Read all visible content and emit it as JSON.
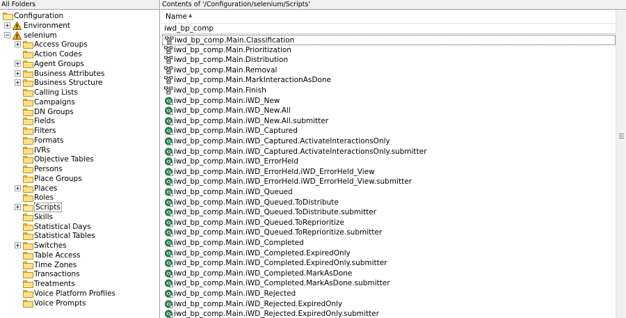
{
  "left_pane": {
    "header": "All Folders",
    "tree": [
      {
        "label": "Configuration",
        "level": 0,
        "expander": "none",
        "icon": "folder-open-icon"
      },
      {
        "label": "Environment",
        "level": 1,
        "expander": "plus",
        "icon": "warning-icon"
      },
      {
        "label": "selenium",
        "level": 1,
        "expander": "minus",
        "icon": "warning-icon"
      },
      {
        "label": "Access Groups",
        "level": 2,
        "expander": "plus",
        "icon": "folder-icon"
      },
      {
        "label": "Action Codes",
        "level": 2,
        "expander": "none",
        "icon": "folder-icon"
      },
      {
        "label": "Agent Groups",
        "level": 2,
        "expander": "plus",
        "icon": "folder-icon"
      },
      {
        "label": "Business Attributes",
        "level": 2,
        "expander": "plus",
        "icon": "folder-icon"
      },
      {
        "label": "Business Structure",
        "level": 2,
        "expander": "plus",
        "icon": "folder-icon"
      },
      {
        "label": "Calling Lists",
        "level": 2,
        "expander": "none",
        "icon": "folder-icon"
      },
      {
        "label": "Campaigns",
        "level": 2,
        "expander": "none",
        "icon": "folder-icon"
      },
      {
        "label": "DN Groups",
        "level": 2,
        "expander": "none",
        "icon": "folder-icon"
      },
      {
        "label": "Fields",
        "level": 2,
        "expander": "none",
        "icon": "folder-icon"
      },
      {
        "label": "Filters",
        "level": 2,
        "expander": "none",
        "icon": "folder-icon"
      },
      {
        "label": "Formats",
        "level": 2,
        "expander": "none",
        "icon": "folder-icon"
      },
      {
        "label": "IVRs",
        "level": 2,
        "expander": "none",
        "icon": "folder-icon"
      },
      {
        "label": "Objective Tables",
        "level": 2,
        "expander": "none",
        "icon": "folder-icon"
      },
      {
        "label": "Persons",
        "level": 2,
        "expander": "none",
        "icon": "folder-icon"
      },
      {
        "label": "Place Groups",
        "level": 2,
        "expander": "none",
        "icon": "folder-icon"
      },
      {
        "label": "Places",
        "level": 2,
        "expander": "plus",
        "icon": "folder-icon"
      },
      {
        "label": "Roles",
        "level": 2,
        "expander": "none",
        "icon": "folder-icon"
      },
      {
        "label": "Scripts",
        "level": 2,
        "expander": "plus",
        "icon": "folder-open-icon",
        "selected": true
      },
      {
        "label": "Skills",
        "level": 2,
        "expander": "none",
        "icon": "folder-icon"
      },
      {
        "label": "Statistical Days",
        "level": 2,
        "expander": "none",
        "icon": "folder-icon"
      },
      {
        "label": "Statistical Tables",
        "level": 2,
        "expander": "none",
        "icon": "folder-icon"
      },
      {
        "label": "Switches",
        "level": 2,
        "expander": "plus",
        "icon": "folder-icon"
      },
      {
        "label": "Table Access",
        "level": 2,
        "expander": "none",
        "icon": "folder-icon"
      },
      {
        "label": "Time Zones",
        "level": 2,
        "expander": "none",
        "icon": "folder-icon"
      },
      {
        "label": "Transactions",
        "level": 2,
        "expander": "none",
        "icon": "folder-icon"
      },
      {
        "label": "Treatments",
        "level": 2,
        "expander": "none",
        "icon": "folder-icon"
      },
      {
        "label": "Voice Platform Profiles",
        "level": 2,
        "expander": "none",
        "icon": "folder-icon"
      },
      {
        "label": "Voice Prompts",
        "level": 2,
        "expander": "none",
        "icon": "folder-icon"
      }
    ]
  },
  "right_pane": {
    "header": "Contents of '/Configuration/selenium/Scripts'",
    "column_name": "Name",
    "sort_indicator": "▲",
    "filter_value": "iwd_bp_comp",
    "items": [
      {
        "label": "iwd_bp_comp.Main.Classification",
        "icon": "workflow-icon"
      },
      {
        "label": "iwd_bp_comp.Main.Prioritization",
        "icon": "workflow-icon"
      },
      {
        "label": "iwd_bp_comp.Main.Distribution",
        "icon": "workflow-icon"
      },
      {
        "label": "iwd_bp_comp.Main.Removal",
        "icon": "workflow-icon"
      },
      {
        "label": "iwd_bp_comp.Main.MarkInteractionAsDone",
        "icon": "workflow-icon"
      },
      {
        "label": "iwd_bp_comp.Main.Finish",
        "icon": "workflow-icon"
      },
      {
        "label": "iwd_bp_comp.Main.iWD_New",
        "icon": "queue-icon"
      },
      {
        "label": "iwd_bp_comp.Main.iWD_New.All",
        "icon": "queue-icon"
      },
      {
        "label": "iwd_bp_comp.Main.iWD_New.All.submitter",
        "icon": "queue-icon"
      },
      {
        "label": "iwd_bp_comp.Main.iWD_Captured",
        "icon": "queue-icon"
      },
      {
        "label": "iwd_bp_comp.Main.iWD_Captured.ActivateInteractionsOnly",
        "icon": "queue-icon"
      },
      {
        "label": "iwd_bp_comp.Main.iWD_Captured.ActivateInteractionsOnly.submitter",
        "icon": "queue-icon"
      },
      {
        "label": "iwd_bp_comp.Main.iWD_ErrorHeld",
        "icon": "queue-icon"
      },
      {
        "label": "iwd_bp_comp.Main.iWD_ErrorHeld.iWD_ErrorHeld_View",
        "icon": "queue-icon"
      },
      {
        "label": "iwd_bp_comp.Main.iWD_ErrorHeld.iWD_ErrorHeld_View.submitter",
        "icon": "queue-icon"
      },
      {
        "label": "iwd_bp_comp.Main.iWD_Queued",
        "icon": "queue-icon"
      },
      {
        "label": "iwd_bp_comp.Main.iWD_Queued.ToDistribute",
        "icon": "queue-icon"
      },
      {
        "label": "iwd_bp_comp.Main.iWD_Queued.ToDistribute.submitter",
        "icon": "queue-icon"
      },
      {
        "label": "iwd_bp_comp.Main.iWD_Queued.ToReprioritize",
        "icon": "queue-icon"
      },
      {
        "label": "iwd_bp_comp.Main.iWD_Queued.ToReprioritize.submitter",
        "icon": "queue-icon"
      },
      {
        "label": "iwd_bp_comp.Main.iWD_Completed",
        "icon": "queue-icon"
      },
      {
        "label": "iwd_bp_comp.Main.iWD_Completed.ExpiredOnly",
        "icon": "queue-icon"
      },
      {
        "label": "iwd_bp_comp.Main.iWD_Completed.ExpiredOnly.submitter",
        "icon": "queue-icon"
      },
      {
        "label": "iwd_bp_comp.Main.iWD_Completed.MarkAsDone",
        "icon": "queue-icon"
      },
      {
        "label": "iwd_bp_comp.Main.iWD_Completed.MarkAsDone.submitter",
        "icon": "queue-icon"
      },
      {
        "label": "iwd_bp_comp.Main.iWD_Rejected",
        "icon": "queue-icon"
      },
      {
        "label": "iwd_bp_comp.Main.iWD_Rejected.ExpiredOnly",
        "icon": "queue-icon"
      },
      {
        "label": "iwd_bp_comp.Main.iWD_Rejected.ExpiredOnly.submitter",
        "icon": "queue-icon"
      }
    ]
  }
}
